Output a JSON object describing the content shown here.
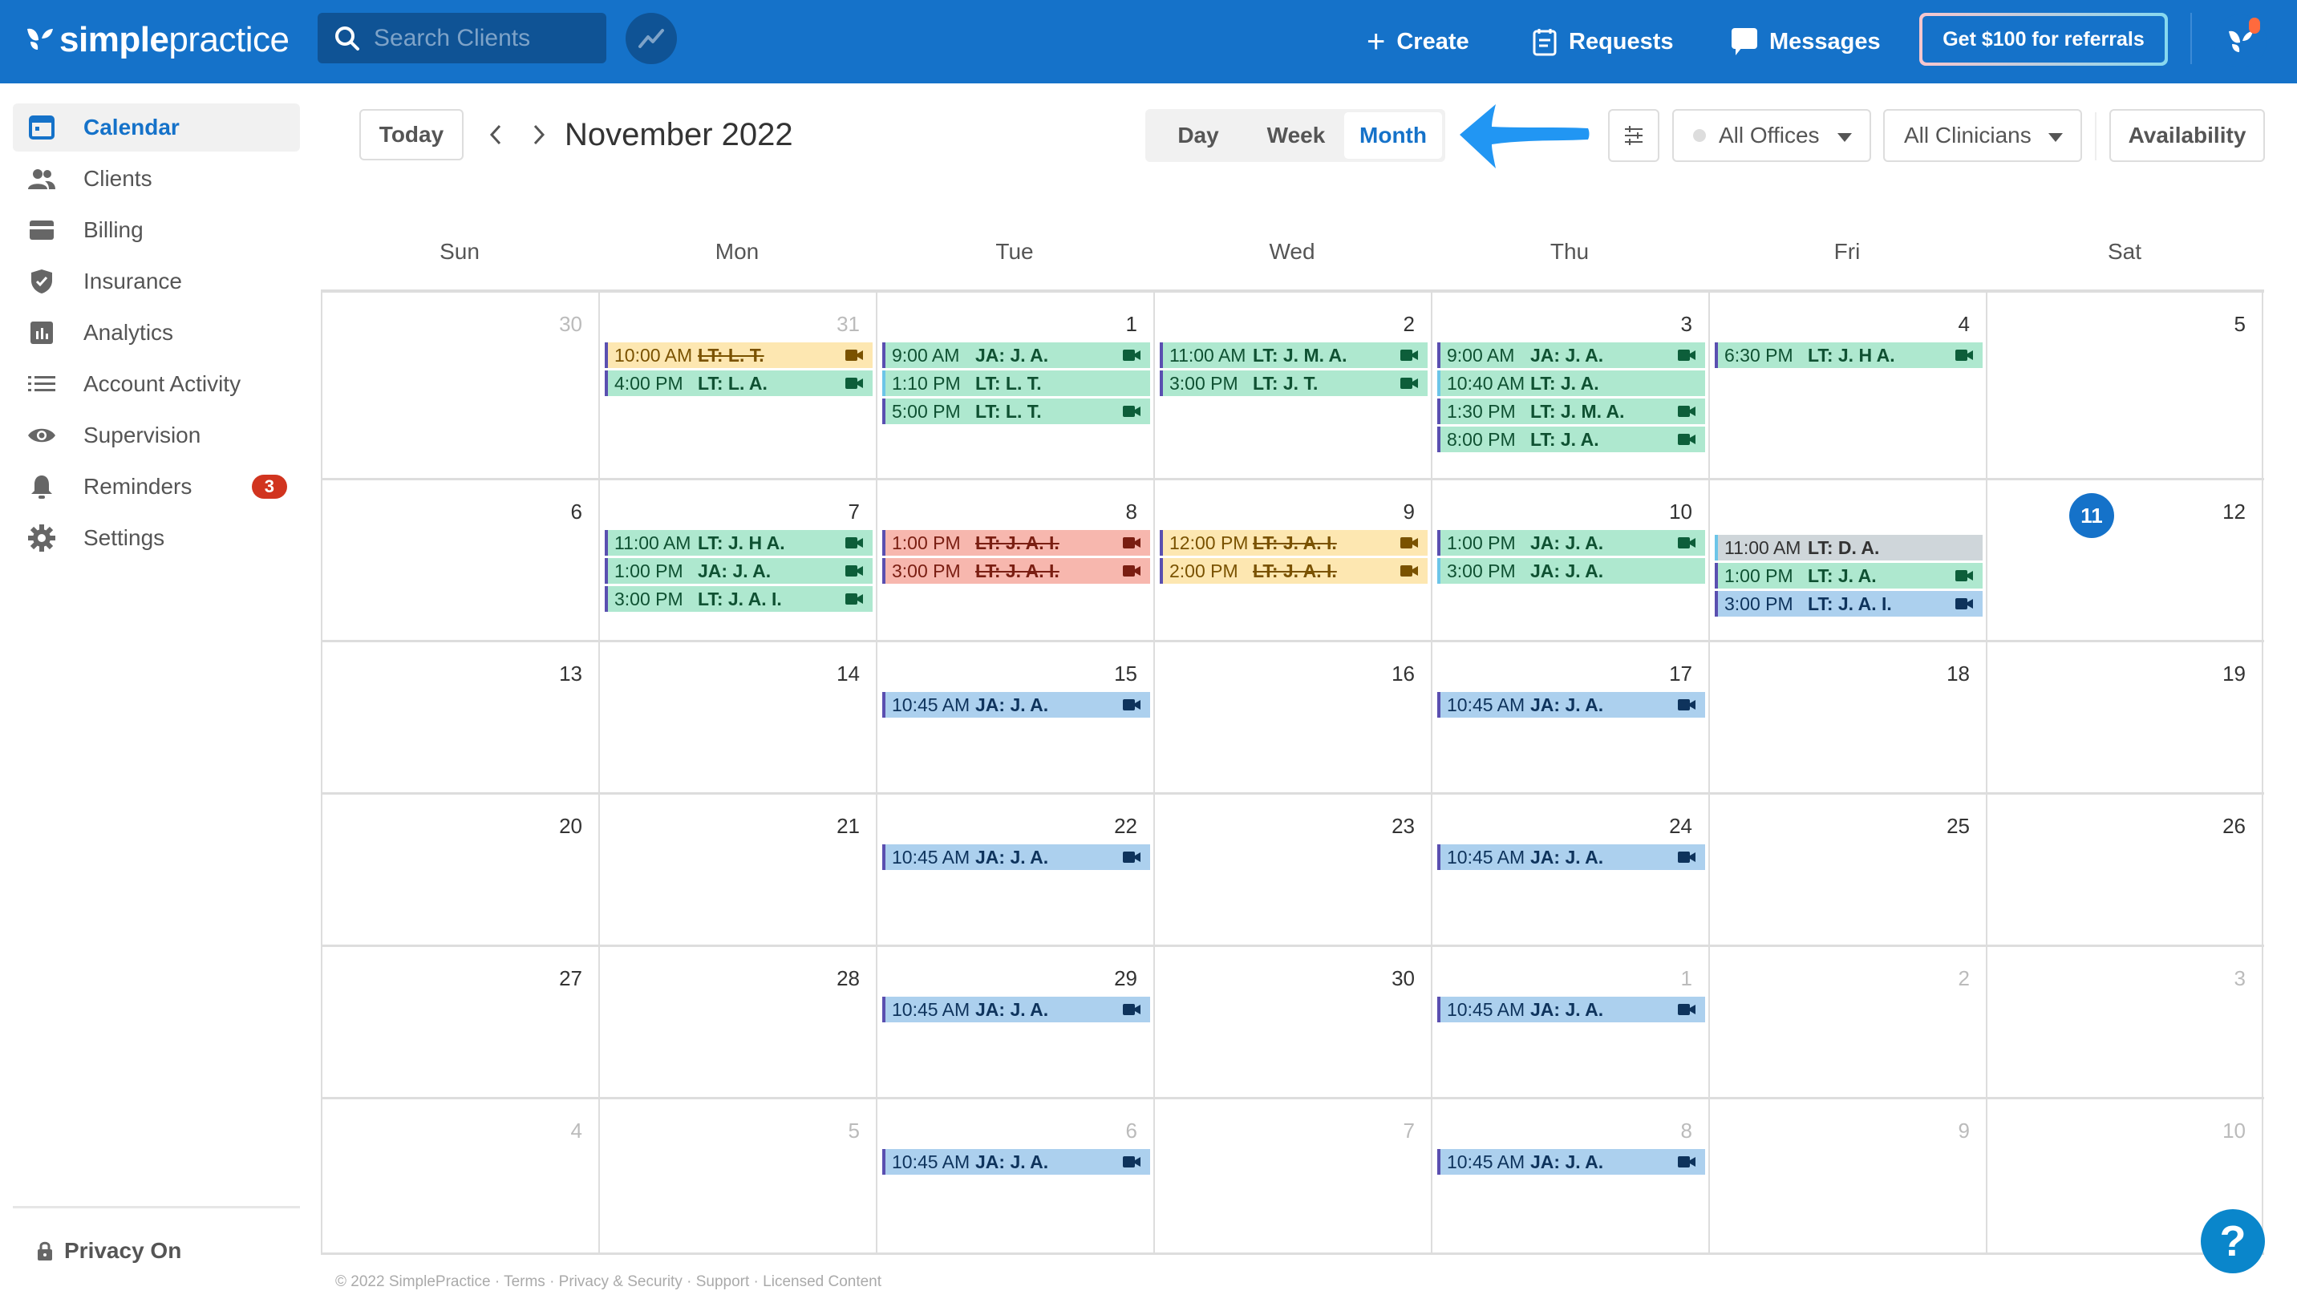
{
  "topbar": {
    "logo_bold": "simple",
    "logo_light": "practice",
    "search_placeholder": "Search Clients",
    "create_label": "Create",
    "requests_label": "Requests",
    "messages_label": "Messages",
    "referral_label": "Get $100 for referrals"
  },
  "sidebar": {
    "items": [
      {
        "label": "Calendar",
        "icon": "calendar-icon",
        "active": true
      },
      {
        "label": "Clients",
        "icon": "clients-icon"
      },
      {
        "label": "Billing",
        "icon": "credit-card-icon"
      },
      {
        "label": "Insurance",
        "icon": "shield-check-icon"
      },
      {
        "label": "Analytics",
        "icon": "bar-chart-icon"
      },
      {
        "label": "Account Activity",
        "icon": "list-icon"
      },
      {
        "label": "Supervision",
        "icon": "eye-icon"
      },
      {
        "label": "Reminders",
        "icon": "bell-icon",
        "badge": "3"
      },
      {
        "label": "Settings",
        "icon": "gear-icon"
      }
    ],
    "privacy_label": "Privacy On"
  },
  "toolbar": {
    "today_label": "Today",
    "month_title": "November 2022",
    "views": [
      "Day",
      "Week",
      "Month"
    ],
    "active_view": "Month",
    "offices_label": "All Offices",
    "clinicians_label": "All Clinicians",
    "availability_label": "Availability"
  },
  "calendar": {
    "weekdays": [
      "Sun",
      "Mon",
      "Tue",
      "Wed",
      "Thu",
      "Fri",
      "Sat"
    ],
    "today": "11",
    "weeks": [
      [
        {
          "day": "30",
          "muted": true,
          "events": []
        },
        {
          "day": "31",
          "muted": true,
          "events": [
            {
              "time": "10:00 AM",
              "name": "LT: L. T.",
              "color": "yellow",
              "strike": true,
              "video": true
            },
            {
              "time": "4:00 PM",
              "name": "LT: L. A.",
              "color": "green",
              "video": true
            }
          ]
        },
        {
          "day": "1",
          "events": [
            {
              "time": "9:00 AM",
              "name": "JA: J. A.",
              "color": "green",
              "video": true
            },
            {
              "time": "1:10 PM",
              "name": "LT: L. T.",
              "color": "green",
              "lightborder": true
            },
            {
              "time": "5:00 PM",
              "name": "LT: L. T.",
              "color": "green",
              "video": true
            }
          ]
        },
        {
          "day": "2",
          "events": [
            {
              "time": "11:00 AM",
              "name": "LT: J. M. A.",
              "color": "green",
              "video": true
            },
            {
              "time": "3:00 PM",
              "name": "LT: J. T.",
              "color": "green",
              "video": true
            }
          ]
        },
        {
          "day": "3",
          "events": [
            {
              "time": "9:00 AM",
              "name": "JA: J. A.",
              "color": "green",
              "video": true
            },
            {
              "time": "10:40 AM",
              "name": "LT: J. A.",
              "color": "green",
              "lightborder": true
            },
            {
              "time": "1:30 PM",
              "name": "LT: J. M. A.",
              "color": "green",
              "video": true
            },
            {
              "time": "8:00 PM",
              "name": "LT: J. A.",
              "color": "green",
              "video": true
            }
          ]
        },
        {
          "day": "4",
          "events": [
            {
              "time": "6:30 PM",
              "name": "LT: J. H A.",
              "color": "green",
              "video": true
            }
          ]
        },
        {
          "day": "5",
          "events": []
        }
      ],
      [
        {
          "day": "6",
          "events": []
        },
        {
          "day": "7",
          "events": [
            {
              "time": "11:00 AM",
              "name": "LT: J. H A.",
              "color": "green",
              "video": true
            },
            {
              "time": "1:00 PM",
              "name": "JA: J. A.",
              "color": "green",
              "video": true
            },
            {
              "time": "3:00 PM",
              "name": "LT: J. A. I.",
              "color": "green",
              "video": true
            }
          ]
        },
        {
          "day": "8",
          "events": [
            {
              "time": "1:00 PM",
              "name": "LT: J. A. I.",
              "color": "red",
              "strike": true,
              "video": true
            },
            {
              "time": "3:00 PM",
              "name": "LT: J. A. I.",
              "color": "red",
              "strike": true,
              "video": true
            }
          ]
        },
        {
          "day": "9",
          "events": [
            {
              "time": "12:00 PM",
              "name": "LT: J. A. I.",
              "color": "yellow",
              "strike": true,
              "video": true
            },
            {
              "time": "2:00 PM",
              "name": "LT: J. A. I.",
              "color": "yellow",
              "strike": true,
              "video": true
            }
          ]
        },
        {
          "day": "10",
          "events": [
            {
              "time": "1:00 PM",
              "name": "JA: J. A.",
              "color": "green",
              "video": true
            },
            {
              "time": "3:00 PM",
              "name": "JA: J. A.",
              "color": "green",
              "lightborder": true
            }
          ]
        },
        {
          "day": "11",
          "today": true,
          "events": [
            {
              "time": "11:00 AM",
              "name": "LT: D. A.",
              "color": "grey",
              "lightborder": true
            },
            {
              "time": "1:00 PM",
              "name": "LT: J. A.",
              "color": "green",
              "video": true
            },
            {
              "time": "3:00 PM",
              "name": "LT: J. A. I.",
              "color": "blue",
              "video": true
            }
          ]
        },
        {
          "day": "12",
          "events": []
        }
      ],
      [
        {
          "day": "13",
          "events": []
        },
        {
          "day": "14",
          "events": []
        },
        {
          "day": "15",
          "events": [
            {
              "time": "10:45 AM",
              "name": "JA: J. A.",
              "color": "blue",
              "video": true
            }
          ]
        },
        {
          "day": "16",
          "events": []
        },
        {
          "day": "17",
          "events": [
            {
              "time": "10:45 AM",
              "name": "JA: J. A.",
              "color": "blue",
              "video": true
            }
          ]
        },
        {
          "day": "18",
          "events": []
        },
        {
          "day": "19",
          "events": []
        }
      ],
      [
        {
          "day": "20",
          "events": []
        },
        {
          "day": "21",
          "events": []
        },
        {
          "day": "22",
          "events": [
            {
              "time": "10:45 AM",
              "name": "JA: J. A.",
              "color": "blue",
              "video": true
            }
          ]
        },
        {
          "day": "23",
          "events": []
        },
        {
          "day": "24",
          "events": [
            {
              "time": "10:45 AM",
              "name": "JA: J. A.",
              "color": "blue",
              "video": true
            }
          ]
        },
        {
          "day": "25",
          "events": []
        },
        {
          "day": "26",
          "events": []
        }
      ],
      [
        {
          "day": "27",
          "events": []
        },
        {
          "day": "28",
          "events": []
        },
        {
          "day": "29",
          "events": [
            {
              "time": "10:45 AM",
              "name": "JA: J. A.",
              "color": "blue",
              "video": true
            }
          ]
        },
        {
          "day": "30",
          "events": []
        },
        {
          "day": "1",
          "muted": true,
          "events": [
            {
              "time": "10:45 AM",
              "name": "JA: J. A.",
              "color": "blue",
              "video": true
            }
          ]
        },
        {
          "day": "2",
          "muted": true,
          "events": []
        },
        {
          "day": "3",
          "muted": true,
          "events": []
        }
      ],
      [
        {
          "day": "4",
          "muted": true,
          "events": []
        },
        {
          "day": "5",
          "muted": true,
          "events": []
        },
        {
          "day": "6",
          "muted": true,
          "events": [
            {
              "time": "10:45 AM",
              "name": "JA: J. A.",
              "color": "blue",
              "video": true
            }
          ]
        },
        {
          "day": "7",
          "muted": true,
          "events": []
        },
        {
          "day": "8",
          "muted": true,
          "events": [
            {
              "time": "10:45 AM",
              "name": "JA: J. A.",
              "color": "blue",
              "video": true
            }
          ]
        },
        {
          "day": "9",
          "muted": true,
          "events": []
        },
        {
          "day": "10",
          "muted": true,
          "events": []
        }
      ]
    ]
  },
  "footer": {
    "text": "© 2022 SimplePractice · Terms · Privacy & Security · Support · Licensed Content"
  },
  "colors": {
    "brand": "#1572c9",
    "event_green": "#aee8cf",
    "event_yellow": "#fde7b1",
    "event_red": "#f7b7ae",
    "event_blue": "#acd0ee",
    "event_grey": "#cfd6da",
    "badge_red": "#d1341f"
  }
}
